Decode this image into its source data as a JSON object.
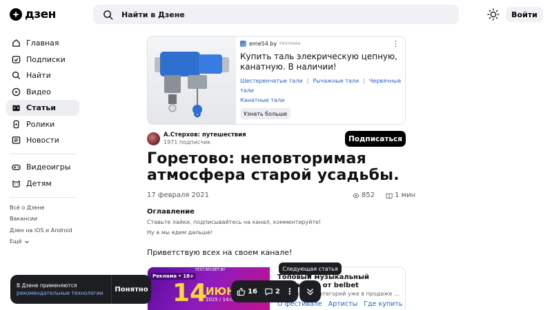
{
  "header": {
    "logo_text": "дзен",
    "search_placeholder": "Найти в Дзене",
    "login_label": "Войти"
  },
  "sidebar": {
    "items": [
      {
        "label": "Главная",
        "icon": "home-icon",
        "active": false
      },
      {
        "label": "Подписки",
        "icon": "subscriptions-icon",
        "active": false
      },
      {
        "label": "Найти",
        "icon": "search-icon",
        "active": false
      },
      {
        "label": "Видео",
        "icon": "video-icon",
        "active": false
      },
      {
        "label": "Статьи",
        "icon": "articles-icon",
        "active": true
      },
      {
        "label": "Ролики",
        "icon": "shorts-icon",
        "active": false
      },
      {
        "label": "Новости",
        "icon": "news-icon",
        "active": false
      }
    ],
    "extra_items": [
      {
        "label": "Видеоигры",
        "icon": "gamepad-icon"
      },
      {
        "label": "Детям",
        "icon": "kids-icon"
      }
    ],
    "footer_links": [
      "Всё о Дзене",
      "Вакансии",
      "Дзен на iOS и Android"
    ],
    "more_label": "Ещё"
  },
  "ad": {
    "source": "eme54.by",
    "tag": "РЕКЛАМА",
    "title": "Купить таль элекрическую цепную, канатную. В наличии!",
    "links": [
      "Шестеренчатые тали",
      "Рычажные тали",
      "Червячные тали",
      "Канатные тали"
    ],
    "cta": "Узнать больше"
  },
  "author": {
    "name": "А.Стерхов: путешествия",
    "subscribers": "1971 подписчик",
    "subscribe_label": "Подписаться"
  },
  "article": {
    "title": "Горетово: неповторимая атмосфера старой усадьбы.",
    "date": "17 февраля 2021",
    "views": "852",
    "read_time": "1 мин",
    "toc_heading": "Оглавление",
    "toc_lines": [
      "Ставьте лайки, подписывайтесь на канал, комментируйте!",
      "Ну а мы едем дальше!"
    ],
    "greeting": "Приветствую всех на своем канале!"
  },
  "card": {
    "badge": "Реклама • 18+",
    "site": "FEST.BELBET.BY",
    "big_number": "14",
    "month": "ИЮНЯ",
    "date_line": "2025 / 14:00",
    "title": "Топовый музыкальный фестиваль от belbet",
    "description": "Билеты всех категорий уже в продаже – в...",
    "links": [
      "О фестивале",
      "Артисты",
      "Где купить"
    ]
  },
  "cookie": {
    "text": "В Дзене применяются",
    "link": "рекомендательные технологии",
    "button": "Понятно"
  },
  "actions": {
    "likes": "16",
    "comments": "2",
    "tooltip": "Следующая статья"
  }
}
